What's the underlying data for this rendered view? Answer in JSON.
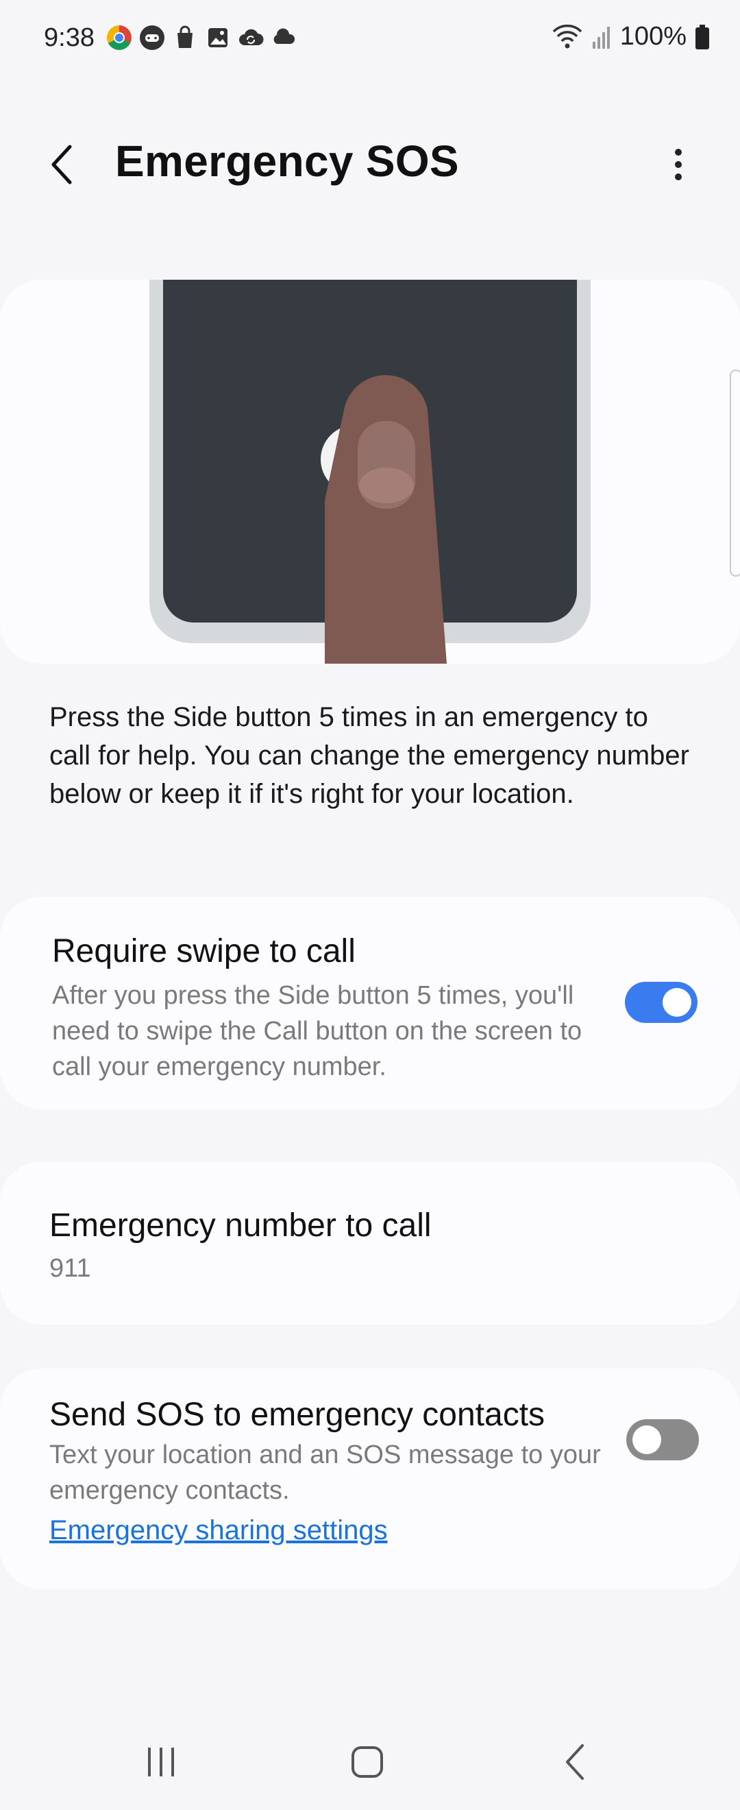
{
  "status_bar": {
    "time": "9:38",
    "battery": "100%",
    "icons_left": [
      "chrome-like-icon",
      "game-controller-icon",
      "shopping-bag-icon",
      "gallery-icon",
      "sync-cloud-icon",
      "cloud-icon"
    ],
    "icons_right": [
      "wifi-icon",
      "signal-icon",
      "battery-icon"
    ]
  },
  "app_bar": {
    "title": "Emergency SOS"
  },
  "illustration": {
    "screen_color": "#363a41",
    "frame_color": "#d6d9dc",
    "finger_color": "#7e5a52"
  },
  "description": "Press the Side button 5 times in an emergency to call for help. You can change the emergency number below or keep it if it's right for your location.",
  "settings": {
    "swipe": {
      "title": "Require swipe to call",
      "subtitle": "After you press the Side button 5 times, you'll need to swipe the Call button on the screen to call your emergency number.",
      "enabled": true
    },
    "number": {
      "title": "Emergency number to call",
      "value": "911"
    },
    "sos_contacts": {
      "title": "Send SOS to emergency contacts",
      "subtitle": "Text your location and an SOS message to your emergency contacts.",
      "link": "Emergency sharing settings",
      "enabled": false
    }
  },
  "colors": {
    "accent": "#3a7bf0",
    "toggle_off": "#8a8a8a",
    "link": "#1a73d8"
  }
}
